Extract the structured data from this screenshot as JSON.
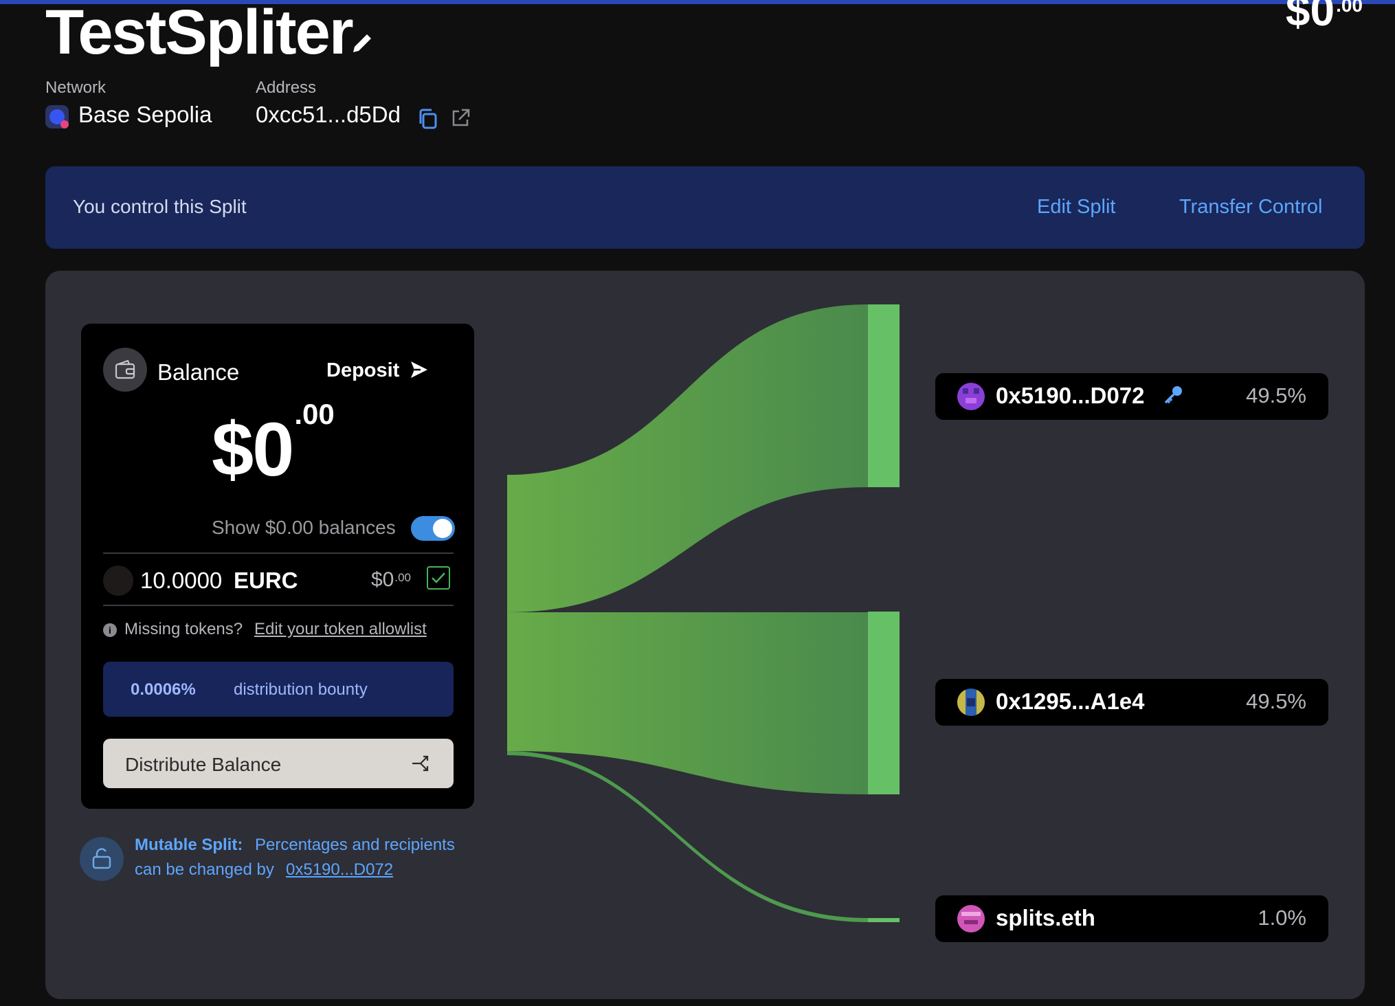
{
  "header": {
    "title": "TestSpliter",
    "top_amount_main": "$0",
    "top_amount_cents": ".00",
    "network_label": "Network",
    "network_value": "Base Sepolia",
    "address_label": "Address",
    "address_value": "0xcc51...d5Dd"
  },
  "control": {
    "text": "You control this Split",
    "edit_label": "Edit Split",
    "transfer_label": "Transfer Control"
  },
  "balance": {
    "title": "Balance",
    "deposit_label": "Deposit",
    "amount_main": "$0",
    "amount_cents": ".00",
    "show_zero_label": "Show $0.00 balances",
    "show_zero_enabled": true,
    "token": {
      "amount": "10.0000",
      "symbol": "EURC",
      "value_main": "$0",
      "value_cents": ".00",
      "selected": true
    },
    "missing_text": "Missing tokens?",
    "allowlist_link": "Edit your token allowlist",
    "bounty_pct": "0.0006%",
    "bounty_text": "distribution bounty",
    "distribute_label": "Distribute Balance"
  },
  "mutable": {
    "bold": "Mutable Split:",
    "text": "Percentages and recipients",
    "text2": "can be changed by",
    "link": "0x5190...D072"
  },
  "recipients": [
    {
      "name": "0x5190...D072",
      "pct": "49.5%",
      "controller": true,
      "avatar_color": "#8a3fd6"
    },
    {
      "name": "0x1295...A1e4",
      "pct": "49.5%",
      "controller": false,
      "avatar_color": "#2c5fb0"
    },
    {
      "name": "splits.eth",
      "pct": "1.0%",
      "controller": false,
      "avatar_color": "#d056b8"
    }
  ],
  "colors": {
    "accent_blue": "#5da6ff",
    "flow_green": "#66c066",
    "panel_bg": "#2e2e36",
    "control_bg": "#19275a"
  },
  "icons": {
    "edit": "pencil-icon",
    "copy": "copy-icon",
    "external": "external-link-icon",
    "wallet": "wallet-icon",
    "deposit": "send-arrow-icon",
    "distribute": "distribute-arrow-icon",
    "lock": "unlock-icon",
    "key": "key-icon"
  }
}
